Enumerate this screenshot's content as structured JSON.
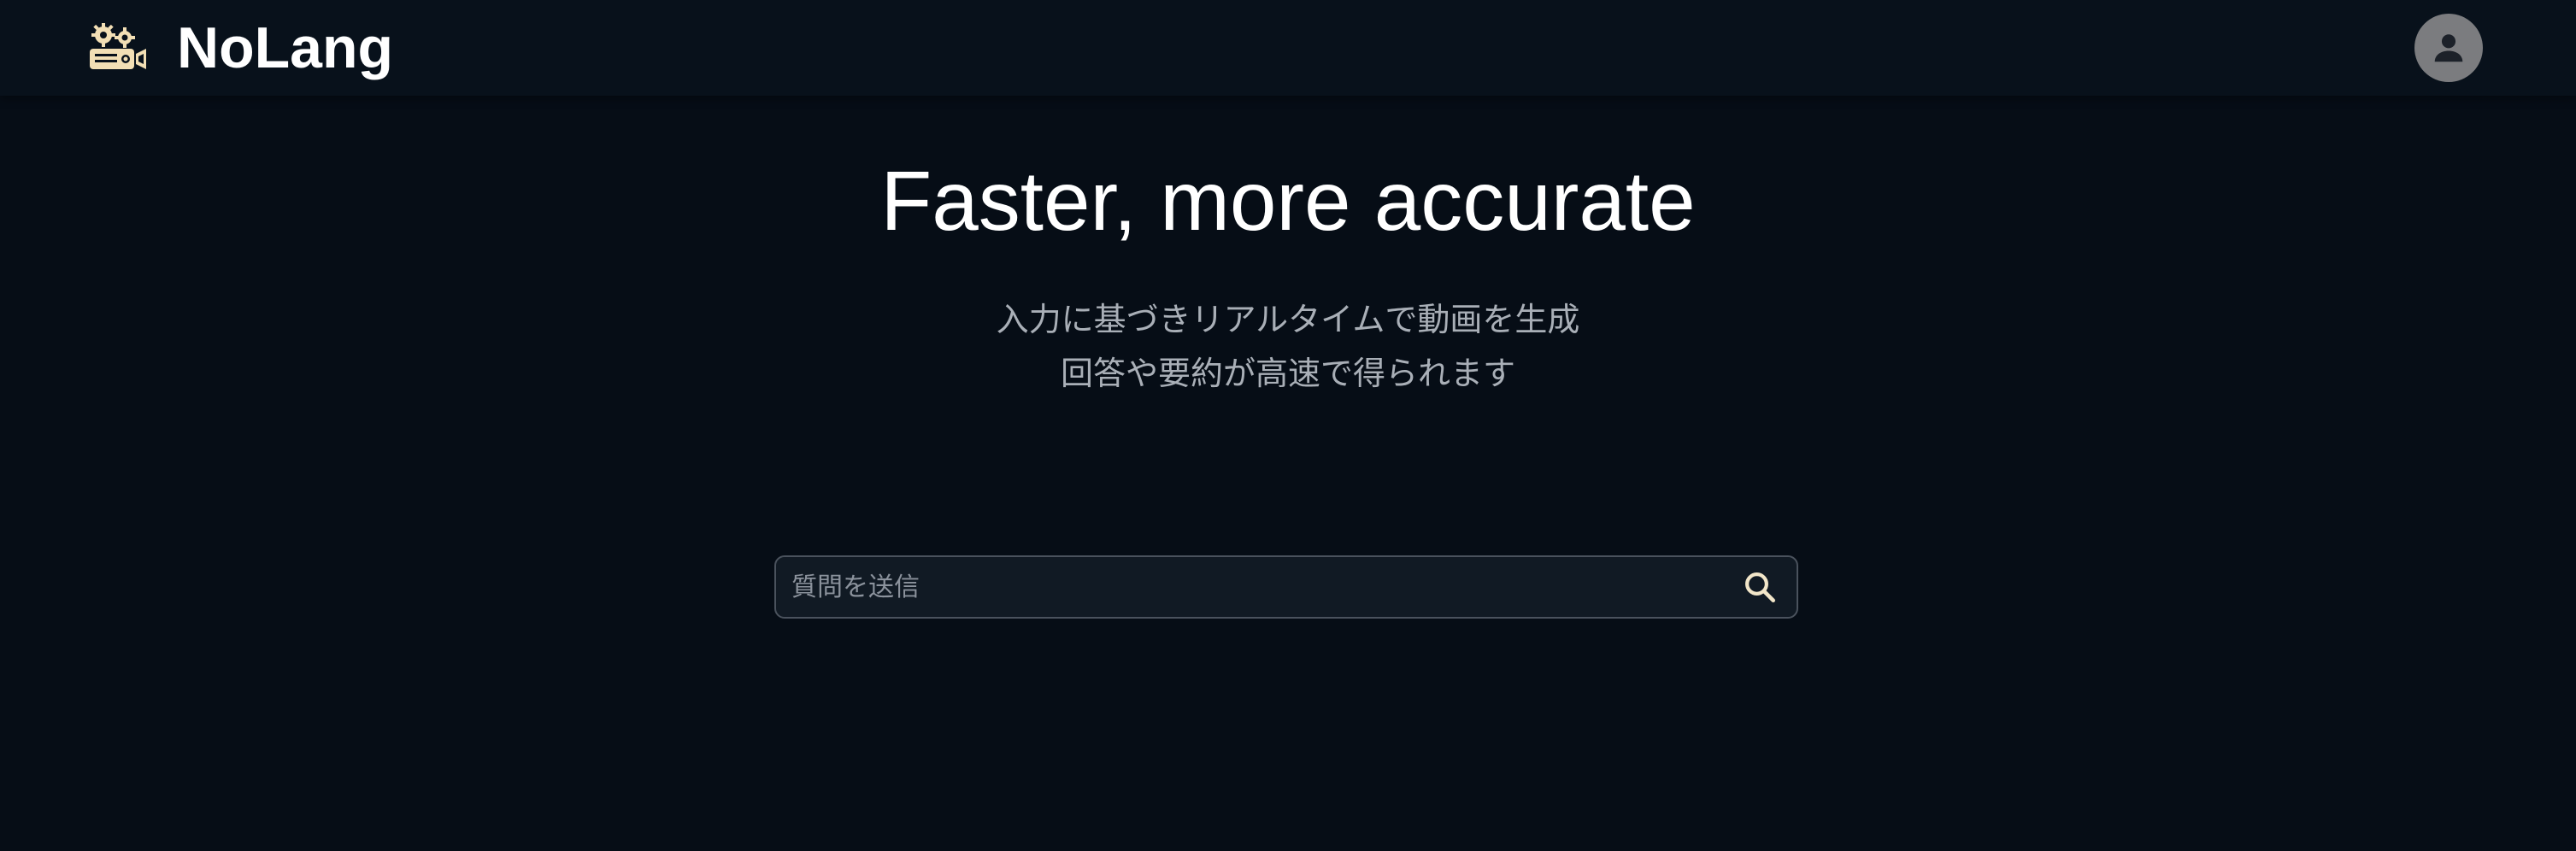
{
  "header": {
    "brand_name": "NoLang",
    "logo_icon": "gear-camera-logo-icon",
    "avatar_icon": "user-avatar-icon"
  },
  "hero": {
    "title": "Faster, more accurate",
    "subtitle_line1": "入力に基づきリアルタイムで動画を生成",
    "subtitle_line2": "回答や要約が高速で得られます"
  },
  "search": {
    "placeholder": "質問を送信",
    "value": "",
    "icon": "search-icon"
  },
  "colors": {
    "background": "#060d16",
    "header": "#08111b",
    "accent_logo": "#f2dfb5",
    "search_icon": "#f2e6c9",
    "avatar": "#7b7c7f"
  }
}
